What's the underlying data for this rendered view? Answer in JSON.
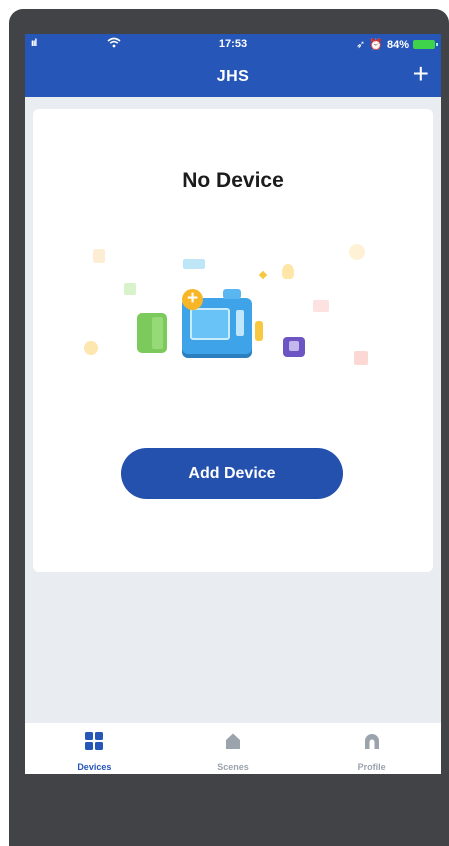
{
  "status_bar": {
    "signal": "ııl",
    "time": "17:53",
    "location": "➶",
    "alarm": "⏰",
    "battery": "84%"
  },
  "header": {
    "title": "JHS",
    "add_icon": "plus-icon"
  },
  "empty_state": {
    "title": "No Device",
    "button_label": "Add Device"
  },
  "tabs": [
    {
      "label": "Devices",
      "icon": "grid-icon",
      "active": true
    },
    {
      "label": "Scenes",
      "icon": "home-icon",
      "active": false
    },
    {
      "label": "Profile",
      "icon": "profile-icon",
      "active": false
    }
  ],
  "colors": {
    "accent": "#2657b8",
    "button": "#2450ae",
    "background": "#e9edf2",
    "tab_inactive": "#9ba3ad"
  }
}
